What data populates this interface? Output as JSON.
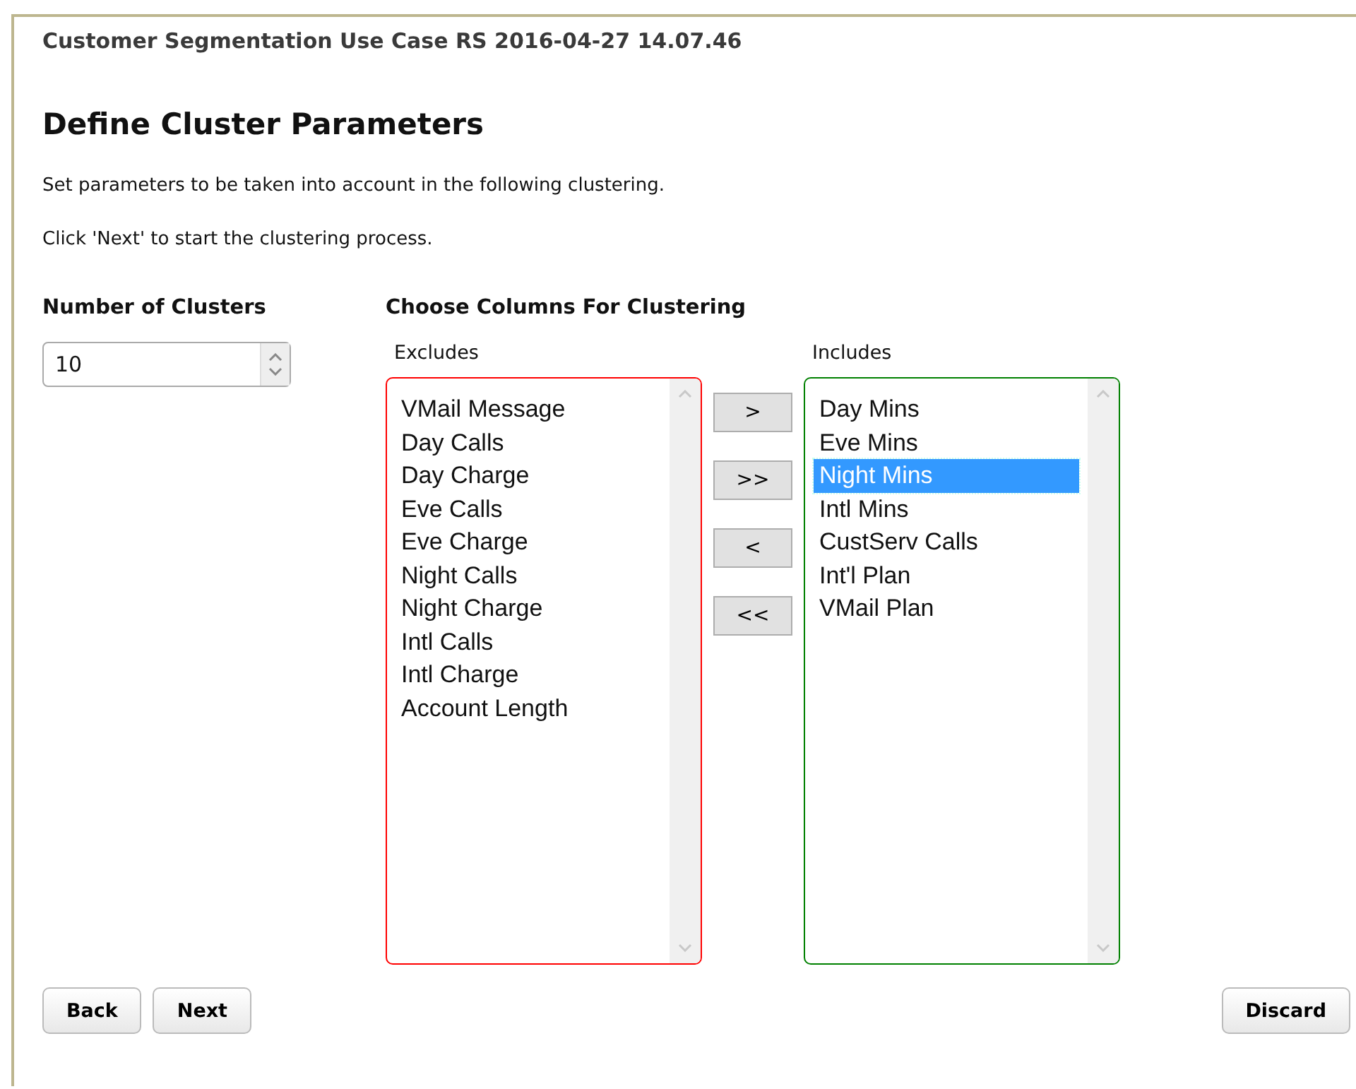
{
  "header": {
    "title": "Customer Segmentation Use Case RS 2016-04-27 14.07.46"
  },
  "heading": "Define Cluster Parameters",
  "instructions": [
    "Set parameters to be taken into account in the following clustering.",
    "Click 'Next' to start the clustering process."
  ],
  "clusters": {
    "label": "Number of Clusters",
    "value": "10"
  },
  "columns": {
    "label": "Choose Columns For Clustering",
    "lists": [
      {
        "label": "Excludes",
        "color": "#ff0000",
        "items": [
          {
            "text": "VMail Message",
            "selected": false
          },
          {
            "text": "Day Calls",
            "selected": false
          },
          {
            "text": "Day Charge",
            "selected": false
          },
          {
            "text": "Eve Calls",
            "selected": false
          },
          {
            "text": "Eve Charge",
            "selected": false
          },
          {
            "text": "Night Calls",
            "selected": false
          },
          {
            "text": "Night Charge",
            "selected": false
          },
          {
            "text": "Intl Calls",
            "selected": false
          },
          {
            "text": "Intl Charge",
            "selected": false
          },
          {
            "text": "Account Length",
            "selected": false
          }
        ]
      },
      {
        "label": "Includes",
        "color": "#008000",
        "items": [
          {
            "text": "Day Mins",
            "selected": false
          },
          {
            "text": "Eve Mins",
            "selected": false
          },
          {
            "text": "Night Mins",
            "selected": true
          },
          {
            "text": "Intl Mins",
            "selected": false
          },
          {
            "text": "CustServ Calls",
            "selected": false
          },
          {
            "text": "Int'l Plan",
            "selected": false
          },
          {
            "text": "VMail Plan",
            "selected": false
          }
        ]
      }
    ],
    "move_buttons": [
      ">",
      ">>",
      "<",
      "<<"
    ]
  },
  "nav_buttons": [
    "Back",
    "Next"
  ],
  "discard_button": "Discard"
}
